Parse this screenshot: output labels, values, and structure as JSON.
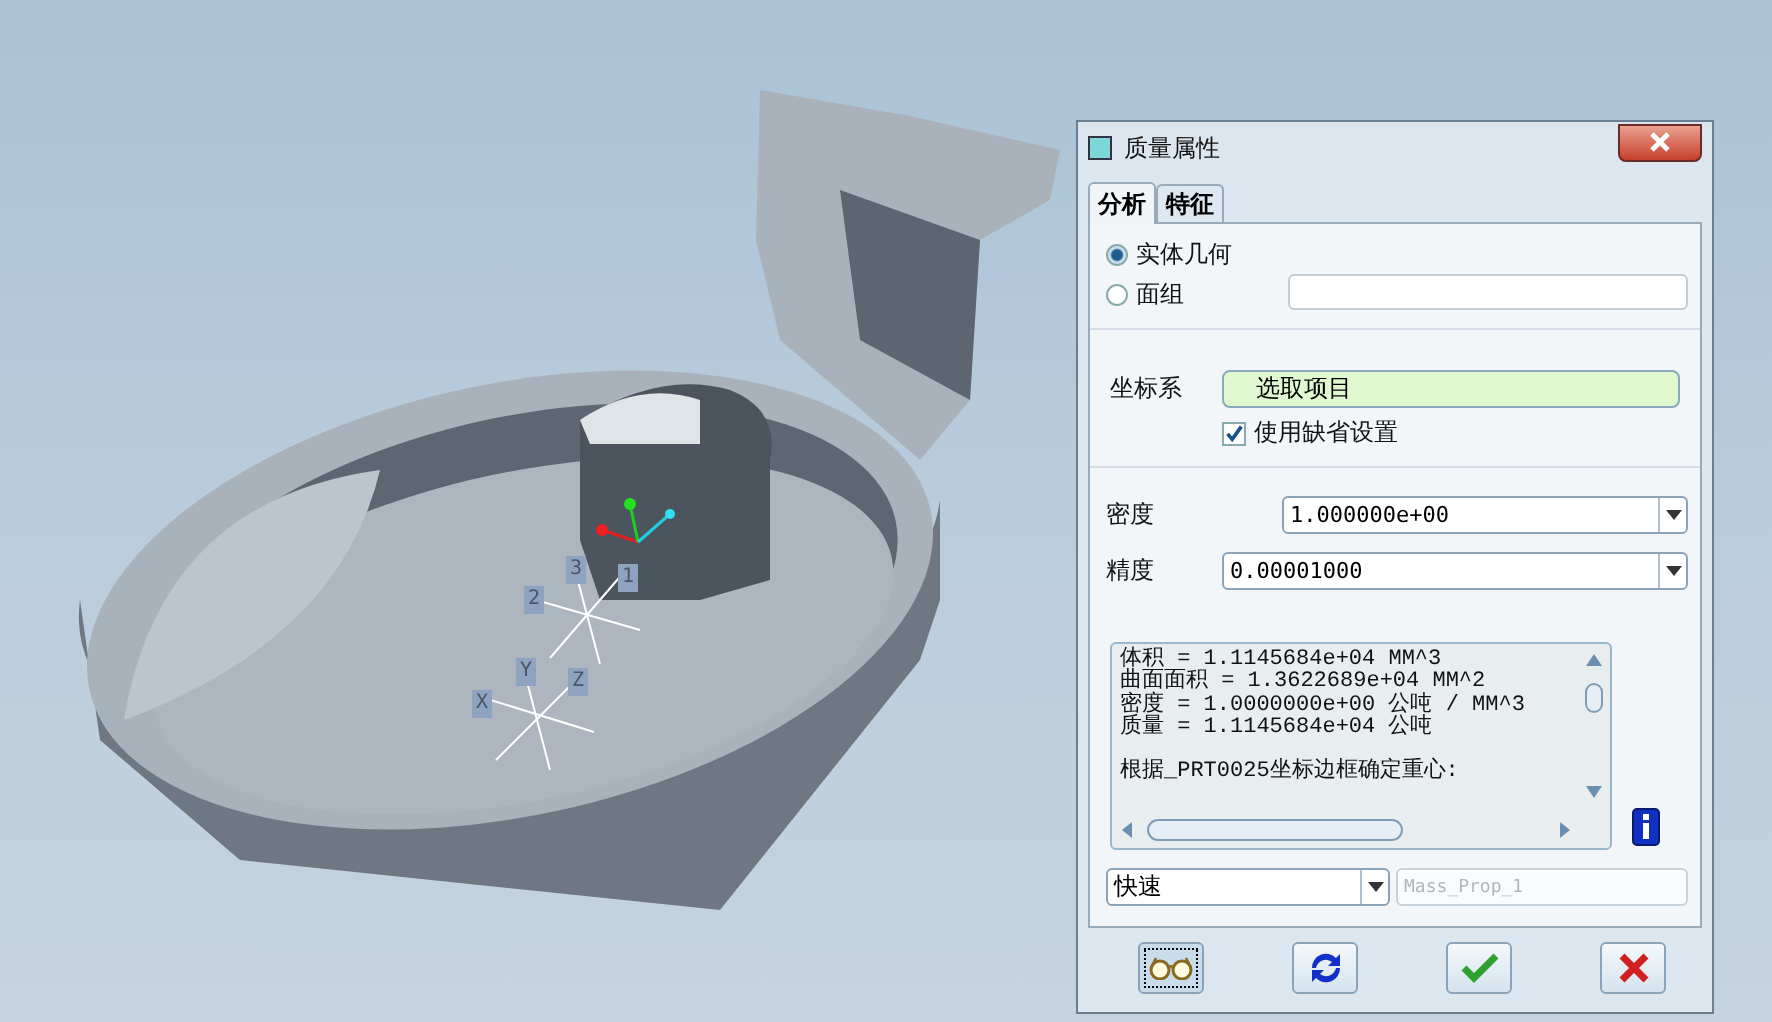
{
  "viewport": {
    "axis_labels": [
      {
        "text": "3",
        "kind": "axis"
      },
      {
        "text": "2",
        "kind": "axis"
      },
      {
        "text": "1",
        "kind": "axis"
      },
      {
        "text": "Y",
        "kind": "axis"
      },
      {
        "text": "Z",
        "kind": "axis"
      },
      {
        "text": "X",
        "kind": "axis"
      }
    ]
  },
  "dialog": {
    "title": "质量属性",
    "tabs": [
      {
        "label": "分析",
        "selected": true
      },
      {
        "label": "特征",
        "selected": false
      }
    ],
    "geometry": [
      {
        "label": "实体几何",
        "selected": true
      },
      {
        "label": "面组",
        "selected": false
      }
    ],
    "csys": {
      "label": "坐标系",
      "value": "选取项目",
      "use_default": {
        "label": "使用缺省设置",
        "checked": true
      }
    },
    "density": {
      "label": "密度",
      "value": "1.000000e+00"
    },
    "accuracy": {
      "label": "精度",
      "value": "0.00001000"
    },
    "results": {
      "lines": [
        "体积 =  1.1145684e+04  MM^3",
        "曲面面积 =  1.3622689e+04  MM^2",
        "密度 =  1.0000000e+00 公吨 / MM^3",
        "质量 =  1.1145684e+04 公吨"
      ],
      "note": "根据_PRT0025坐标边框确定重心:"
    },
    "mode": {
      "value": "快速"
    },
    "feature_name": {
      "placeholder": "Mass_Prop_1"
    }
  }
}
